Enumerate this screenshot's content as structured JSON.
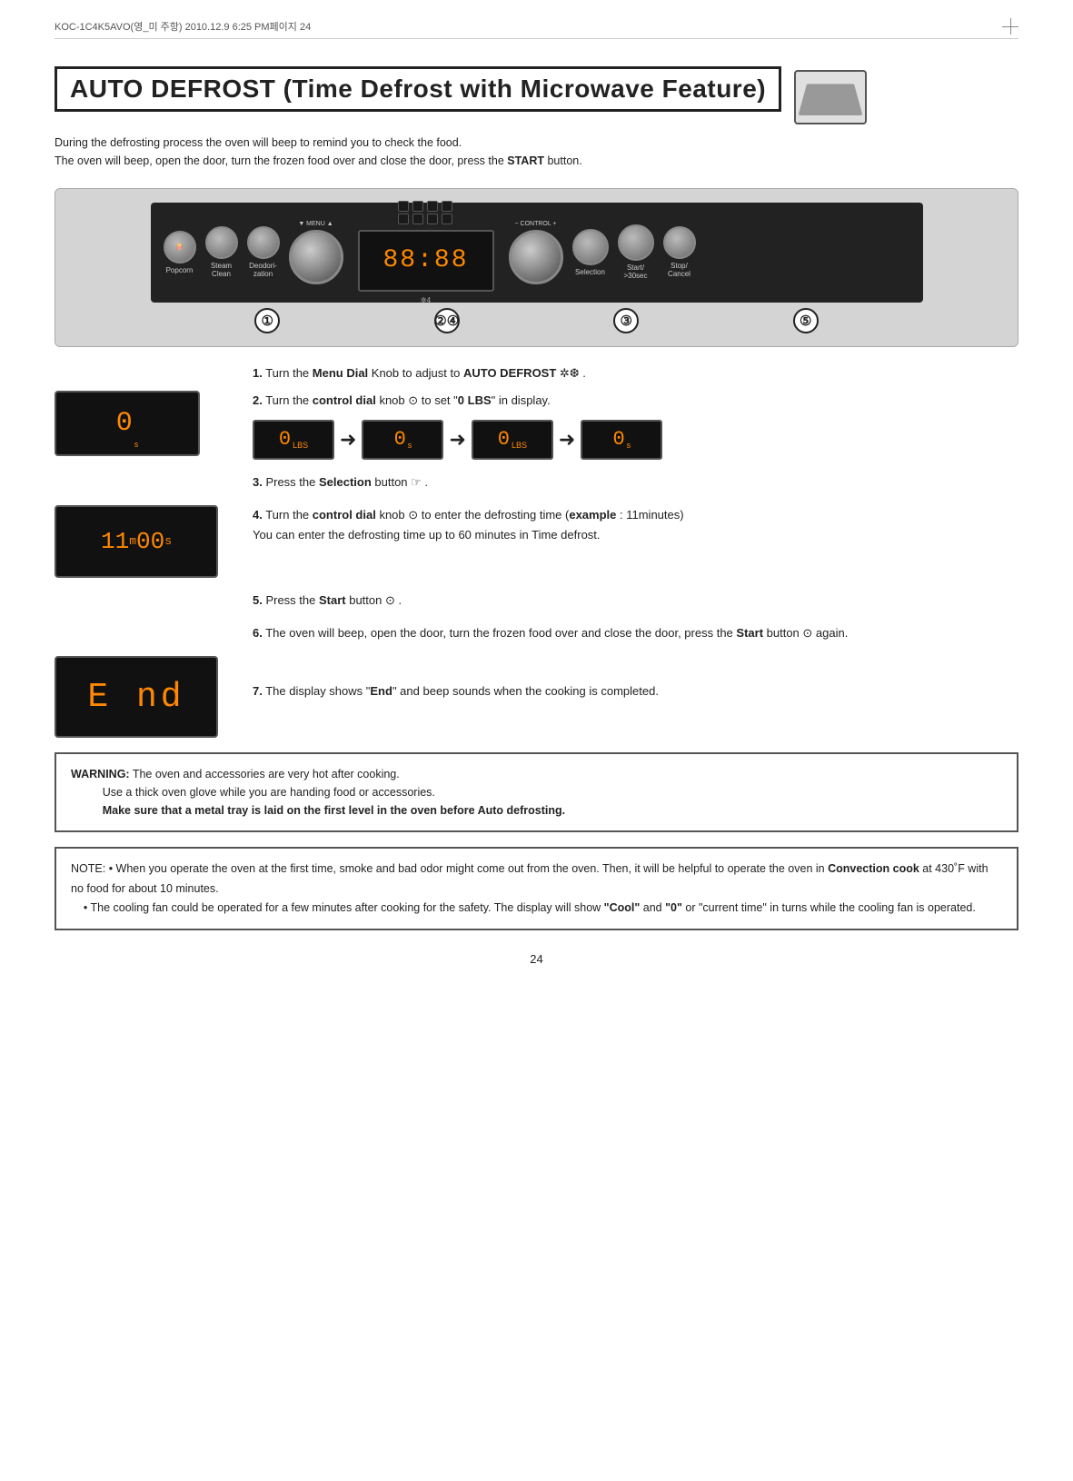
{
  "docHeader": {
    "left": "KOC-1C4K5AVO(영_미 주항) 2010.12.9 6:25 PM페이지 24"
  },
  "title": "AUTO DEFROST (Time Defrost with Microwave Feature)",
  "subtitle": [
    "During the defrosting process the oven will beep to remind you to check the food.",
    "The oven will beep, open the door, turn the frozen food over and close the door, press the START button."
  ],
  "oven": {
    "display": "88:88",
    "buttons": [
      {
        "label": "Popcorn"
      },
      {
        "label": "Steam\nClean"
      },
      {
        "label": "Deodori-\nzation"
      }
    ],
    "rightButtons": [
      {
        "label": "Selection"
      },
      {
        "label": "Start/\n>30sec"
      },
      {
        "label": "Stop/\nCancel"
      }
    ],
    "menuLabel": "MENU",
    "controlLabel": "CONTROL",
    "stepNumbers": [
      "①",
      "②④",
      "③",
      "⑤"
    ]
  },
  "steps": [
    {
      "number": "1",
      "text": "Turn the ",
      "boldPart": "Menu Dial",
      "textAfter": " Knob to adjust to ",
      "boldPart2": "AUTO DEFROST",
      "symbol": " ✲❆",
      "textEnd": " ."
    },
    {
      "number": "2",
      "text": "Turn the ",
      "boldPart": "control dial",
      "textAfter": " knob ⊙ to set \"",
      "boldPart2": "0 LBS",
      "textEnd": "\" in display.",
      "displays": [
        "0\nLBS",
        "0\ns",
        "0\nLBS",
        "0\ns"
      ]
    },
    {
      "number": "3",
      "text": "Press the ",
      "boldPart": "Selection",
      "textAfter": " button ☞ ."
    },
    {
      "number": "4",
      "text": "Turn the ",
      "boldPart": "control dial",
      "textAfter": " knob ⊙  to enter the defrosting time (",
      "boldPart2": "example",
      "textAfter2": " : 11minutes)",
      "sub": "You can enter the defrosting time up to 60 minutes in Time defrost.",
      "displayVal": "11:00"
    },
    {
      "number": "5",
      "text": "Press the ",
      "boldPart": "Start",
      "textAfter": " button ⊙ ."
    },
    {
      "number": "6",
      "text": "The oven will beep, open the door, turn the frozen food over and close the door, press the ",
      "boldPart": "Start",
      "textAfter": " button ⊙ again."
    },
    {
      "number": "7",
      "text": "The display shows \"",
      "boldPart": "End",
      "textAfter": "\" and beep sounds when the cooking is completed.",
      "displayVal": "End"
    }
  ],
  "warning": {
    "label": "WARNING:",
    "lines": [
      "The oven and accessories are very hot after cooking.",
      "Use a thick oven glove while you are handing food or accessories.",
      "Make sure that a metal tray is laid on the first level in the oven before Auto defrosting."
    ]
  },
  "note": {
    "label": "NOTE:",
    "bullets": [
      "When you operate the oven at the first time,  smoke and bad odor might come out from the oven. Then, it will be helpful to operate the oven in Convection cook at 430˚F with no food for about 10 minutes.",
      "The cooling fan could be operated for a few minutes after cooking for the safety. The display will show \"Cool\" and \"0\" or \"current time\" in turns while the cooling fan is operated."
    ],
    "bold1": "Convection cook",
    "bold2": "\"Cool\"",
    "bold3": "\"0\""
  },
  "pageNumber": "24"
}
